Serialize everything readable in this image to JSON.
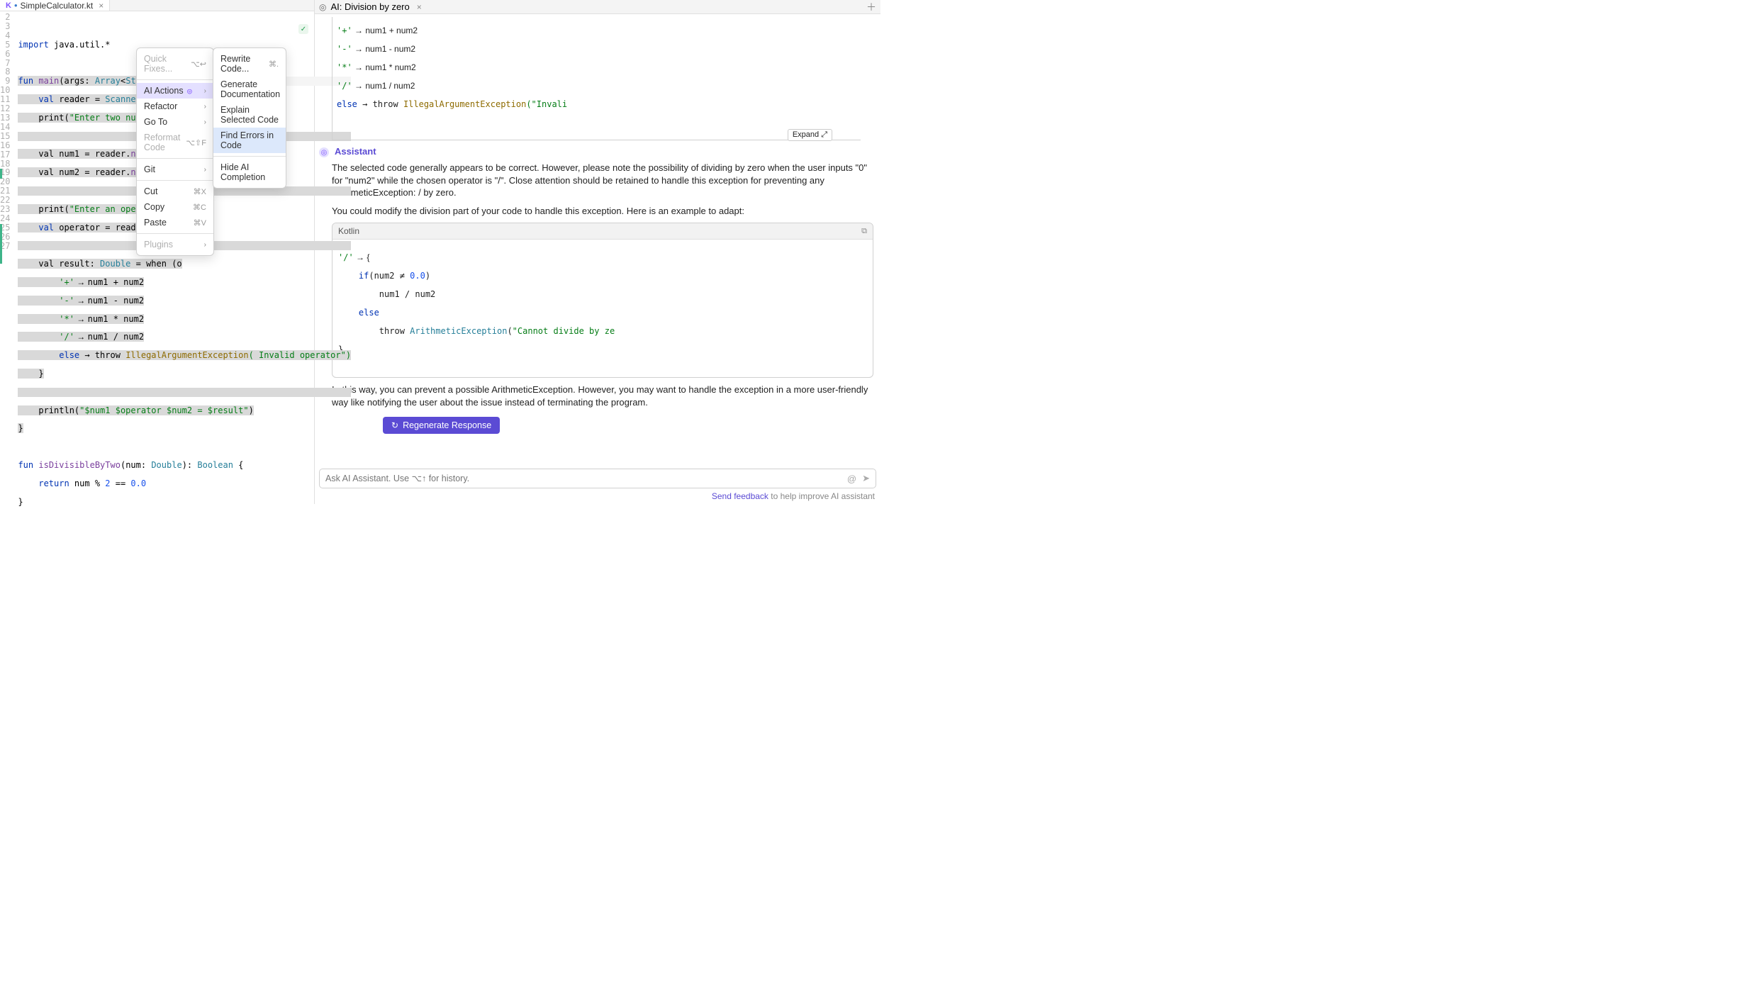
{
  "editor": {
    "tab": {
      "icon": "K",
      "modified_dot": "•",
      "filename": "SimpleCalculator.kt"
    },
    "line_numbers": [
      "",
      "2",
      "3",
      "4",
      "5",
      "6",
      "7",
      "8",
      "9",
      "10",
      "11",
      "12",
      "13",
      "14",
      "15",
      "16",
      "17",
      "18",
      "19",
      "20",
      "21",
      "22",
      "23",
      "24",
      "25",
      "26",
      "27"
    ],
    "code_lines": {
      "l2": "import java.util.*",
      "l4_fun": "fun",
      "l4_main": "main",
      "l4_args": "(args: ",
      "l4_array": "Array",
      "l4_string": "String",
      "l4_end": ">) {",
      "l5": "    val reader = Scanner(System.",
      "l6a": "    print(",
      "l6b": "\"Enter two numbers: \"",
      "l6c": ")",
      "l8": "    val num1 = reader.",
      "l8b": "nextDouble",
      "l9": "    val num2 = reader.",
      "l9b": "nextDouble",
      "l11a": "    print(",
      "l11b": "\"Enter an operator (+,",
      "l12": "    val operator = reader.next()",
      "l14a": "    val result: ",
      "l14b": "Double",
      "l14c": " = when (o",
      "l15a": "        '+'",
      "l15arrow": " → ",
      "l15b": "num1 + num2",
      "l16a": "        '-'",
      "l16b": "num1 - num2",
      "l17a": "        '*'",
      "l17b": "num1 * num2",
      "l18a": "        '/'",
      "l18b": "num1 / num2",
      "l19a": "        else",
      "l19b": " → throw ",
      "l19c": "IllegalArgumentException",
      "l19d": "( Invalid operator\")",
      "l20": "    }",
      "l22a": "    println(",
      "l22b": "\"$num1 $operator $num2 = $result\"",
      "l22c": ")",
      "l23": "}",
      "l25a": "fun",
      "l25b": " isDivisibleByTwo",
      "l25c": "(num: ",
      "l25d": "Double",
      "l25e": "): ",
      "l25f": "Boolean",
      "l25g": " {",
      "l26a": "    return",
      "l26b": " num % ",
      "l26c": "2",
      "l26d": " == ",
      "l26e": "0.0",
      "l27": "}"
    }
  },
  "context_menu": {
    "quick_fixes": "Quick Fixes...",
    "quick_fixes_shortcut": "⌥↩",
    "ai_actions": "AI Actions",
    "refactor": "Refactor",
    "goto": "Go To",
    "reformat": "Reformat Code",
    "reformat_shortcut": "⌥⇧F",
    "git": "Git",
    "cut": "Cut",
    "cut_shortcut": "⌘X",
    "copy": "Copy",
    "copy_shortcut": "⌘C",
    "paste": "Paste",
    "paste_shortcut": "⌘V",
    "plugins": "Plugins"
  },
  "submenu": {
    "rewrite": "Rewrite Code...",
    "rewrite_shortcut": "⌘.",
    "gendoc": "Generate Documentation",
    "explain": "Explain Selected Code",
    "find_errors": "Find Errors in Code",
    "hide": "Hide AI Completion"
  },
  "ai_panel": {
    "tab_title": "AI: Division by zero",
    "top_code": {
      "l1a": "'+'",
      "l1b": " → num1 + num2",
      "l2a": "'-'",
      "l2b": " → num1 - num2",
      "l3a": "'*'",
      "l3b": " → num1 * num2",
      "l4a": "'/'",
      "l4b": " → num1 / num2",
      "l5a": "else",
      "l5b": " → throw ",
      "l5c": "IllegalArgumentException",
      "l5d": "(\"Invali"
    },
    "expand": "Expand ⤢",
    "assistant_label": "Assistant",
    "para1": "The selected code generally appears to be correct. However, please note the possibility of dividing by zero when the user inputs \"0\" for \"num2\" while the chosen operator is \"/\". Close attention should be retained to handle this exception for preventing any ArithmeticException: / by zero.",
    "para2": "You could modify the division part of your code to handle this exception. Here is an example to adapt:",
    "code_lang": "Kotlin",
    "code": {
      "l1a": "'/'",
      "l1b": " → {",
      "l2a": "    if",
      "l2b": "(num2 ≠ ",
      "l2c": "0.0",
      "l2d": ")",
      "l3": "        num1 / num2",
      "l4": "    else",
      "l5a": "        throw ",
      "l5b": "ArithmeticException",
      "l5c": "(",
      "l5d": "\"Cannot divide by ze",
      "l6": "}"
    },
    "para3": "In this way, you can prevent a possible ArithmeticException. However, you may want to handle the exception in a more user-friendly way like notifying the user about the issue instead of terminating the program.",
    "regenerate": "Regenerate Response",
    "input_placeholder": "Ask AI Assistant. Use ⌥↑ for history.",
    "feedback_link": "Send feedback",
    "feedback_rest": " to help improve AI assistant"
  }
}
